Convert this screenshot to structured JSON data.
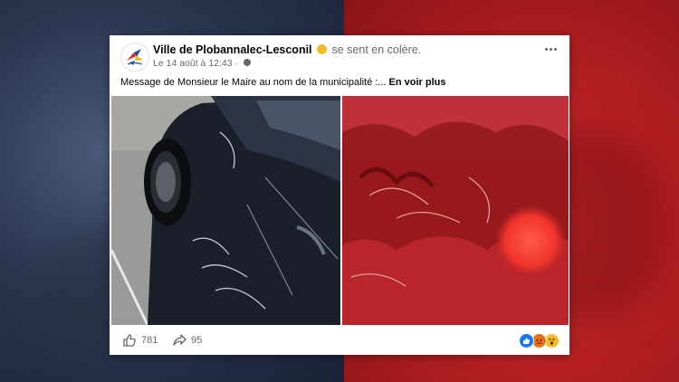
{
  "post": {
    "page_name": "Ville de Plobannalec-Lesconil",
    "feeling_text": "se sent en colère.",
    "feeling_emoji": "angry-face",
    "timestamp": "Le 14 août à 12:43 · ",
    "message_text": "Message de Monsieur le Maire au nom de la municipalité :... ",
    "see_more": "En voir plus",
    "likes": "781",
    "shares": "95",
    "reactions": [
      "like",
      "angry",
      "wow"
    ]
  },
  "colors": {
    "like_blue": "#1877f2",
    "angry_orange": "#e9710f",
    "wow_yellow": "#f7b928",
    "bg_blue": "#2a3550",
    "bg_red": "#b51f22"
  }
}
